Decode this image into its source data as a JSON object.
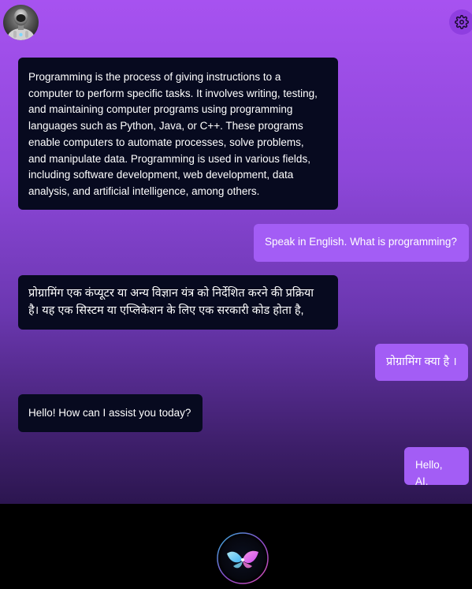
{
  "header": {
    "avatar_icon": "robot-avatar-icon",
    "settings_icon": "gear-icon"
  },
  "messages": [
    {
      "role": "bot",
      "text": "Programming is the process of giving instructions to a\ncomputer to perform specific tasks. It involves writing, testing,\nand maintaining computer programs using programming\nlanguages such as Python, Java, or C++. These programs\nenable computers to automate processes, solve problems,\nand manipulate data. Programming is used in various fields,\nincluding software development, web development, data\nanalysis, and artificial intelligence, among others."
    },
    {
      "role": "user",
      "text": "Speak in English. What is programming?"
    },
    {
      "role": "bot",
      "text": "प्रोग्रामिंग एक कंप्यूटर या अन्य विज्ञान यंत्र को निर्देशित करने की प्रक्रिया\nहै। यह एक सिस्टम या एप्लिकेशन के लिए एक सरकारी कोड होता है,"
    },
    {
      "role": "user",
      "text": "प्रोग्रामिंग क्या है ।"
    },
    {
      "role": "bot",
      "text": "Hello! How can I assist you today?"
    },
    {
      "role": "user",
      "text": "Hello, AI."
    }
  ],
  "footer": {
    "mic_icon": "voice-orb-icon"
  },
  "colors": {
    "bot_bubble": "#070a1f",
    "user_bubble": "#a35df5",
    "gradient_top": "#a752f0",
    "gradient_bottom": "#2c1650"
  }
}
